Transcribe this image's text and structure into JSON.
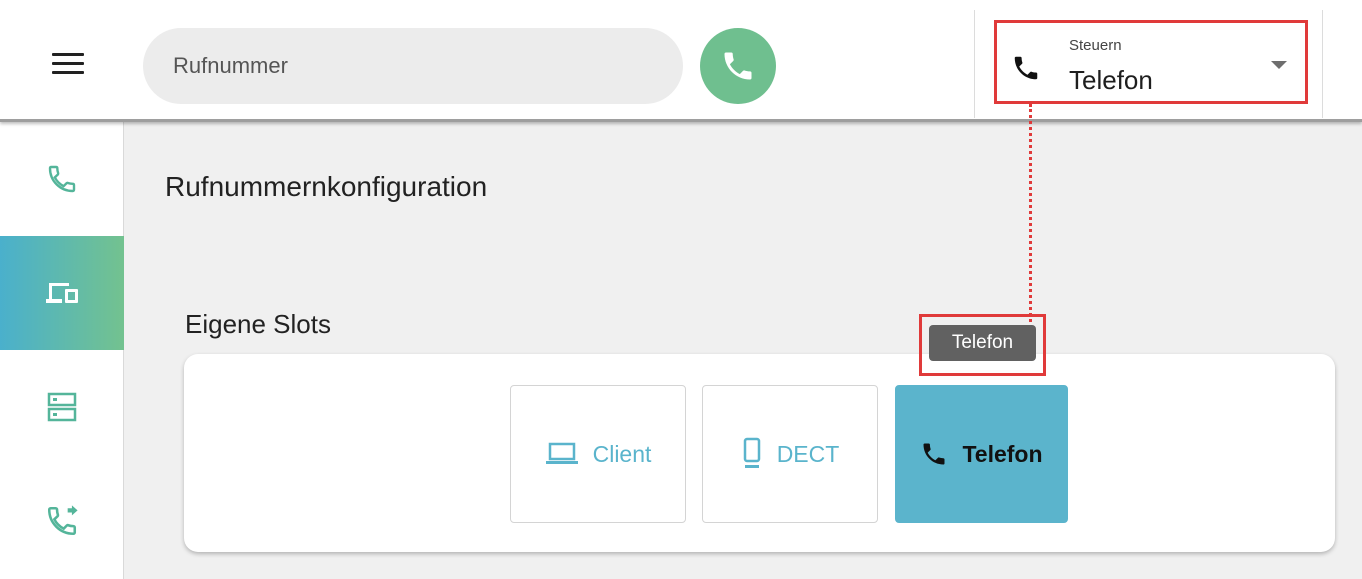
{
  "topbar": {
    "search_placeholder": "Rufnummer",
    "control": {
      "label": "Steuern",
      "value": "Telefon"
    }
  },
  "sidebar": {
    "items": [
      {
        "icon": "phone-icon",
        "active": false
      },
      {
        "icon": "devices-icon",
        "active": true
      },
      {
        "icon": "storage-icon",
        "active": false
      },
      {
        "icon": "call-forward-icon",
        "active": false
      }
    ]
  },
  "main": {
    "title": "Rufnummernkonfiguration",
    "section_title": "Eigene Slots",
    "slots": [
      {
        "label": "Client",
        "icon": "laptop-icon"
      },
      {
        "label": "DECT",
        "icon": "mobile-icon"
      },
      {
        "label": "Telefon",
        "icon": "phone-icon",
        "selected": true
      }
    ],
    "tooltip": "Telefon"
  },
  "colors": {
    "accent_teal": "#5bb4cc",
    "accent_green": "#6fbf8f",
    "highlight_red": "#e03a3a"
  }
}
